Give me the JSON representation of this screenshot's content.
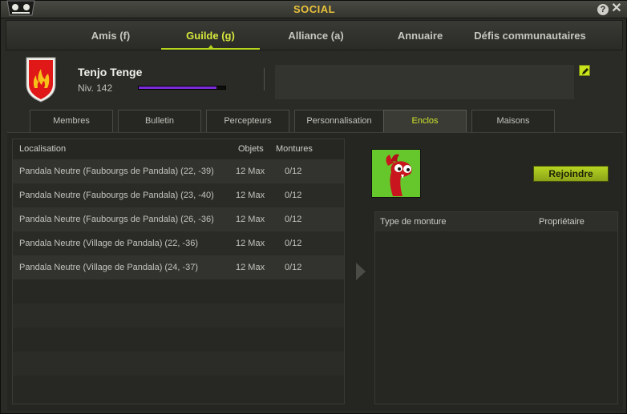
{
  "window": {
    "title": "SOCIAL",
    "help_label": "?",
    "close_label": "✕"
  },
  "main_tabs": [
    {
      "label": "Amis (f)",
      "active": false
    },
    {
      "label": "Guilde (g)",
      "active": true
    },
    {
      "label": "Alliance (a)",
      "active": false
    },
    {
      "label": "Annuaire",
      "active": false
    },
    {
      "label": "Défis communautaires",
      "active": false
    }
  ],
  "guild": {
    "name": "Tenjo Tenge",
    "level": "Niv. 142",
    "xp_progress": 0.9
  },
  "sub_tabs": [
    {
      "label": "Membres",
      "active": false
    },
    {
      "label": "Bulletin",
      "active": false
    },
    {
      "label": "Percepteurs",
      "active": false
    },
    {
      "label": "Personnalisation",
      "active": false
    },
    {
      "label": "Enclos",
      "active": true
    },
    {
      "label": "Maisons",
      "active": false
    }
  ],
  "paddocks": {
    "columns": {
      "location": "Localisation",
      "objects": "Objets",
      "mounts": "Montures"
    },
    "rows": [
      {
        "location": "Pandala Neutre (Faubourgs de Pandala) (22, -39)",
        "objects": "12 Max",
        "mounts": "0/12"
      },
      {
        "location": "Pandala Neutre (Faubourgs de Pandala) (23, -40)",
        "objects": "12 Max",
        "mounts": "0/12"
      },
      {
        "location": "Pandala Neutre (Faubourgs de Pandala) (26, -36)",
        "objects": "12 Max",
        "mounts": "0/12"
      },
      {
        "location": "Pandala Neutre (Village de Pandala) (22, -36)",
        "objects": "12 Max",
        "mounts": "0/12"
      },
      {
        "location": "Pandala Neutre (Village de Pandala) (24, -37)",
        "objects": "12 Max",
        "mounts": "0/12"
      }
    ]
  },
  "detail": {
    "join_label": "Rejoindre",
    "columns": {
      "mount_type": "Type de monture",
      "owner": "Propriétaire"
    }
  },
  "colors": {
    "accent": "#cfe62b",
    "title": "#e9c23a",
    "xp": "#7a2bd8"
  }
}
